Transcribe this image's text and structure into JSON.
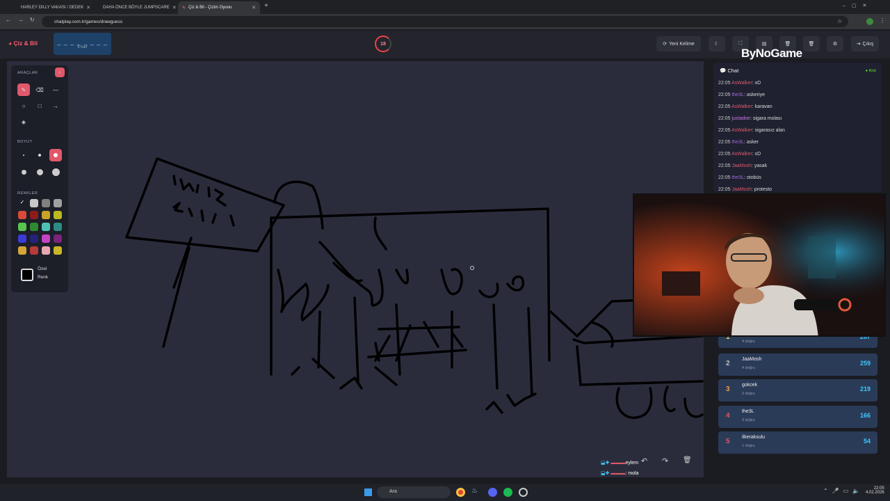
{
  "browser": {
    "tabs": [
      {
        "label": "HARLEY DILLY VAKASI / DEDEK"
      },
      {
        "label": "DAHA ÖNCE BÖYLE JUMPSCARE"
      },
      {
        "label": "Çiz & Bil - Çizim Oyunu"
      }
    ],
    "url": "chatplay.com.tr/games/drawguess"
  },
  "header": {
    "logo": "Çiz & Bil",
    "word_dashes": "_ _ _ _ _ _ _ _",
    "word_hint": "8 harf",
    "timer": "18",
    "new_word": "Yeni Kelime",
    "exit": "Çıkış",
    "watermark": "ByNoGame"
  },
  "tools": {
    "tools_title": "ARAÇLAR",
    "size_title": "BOYUT",
    "colors_title": "RENKLER",
    "custom_color": "Özel",
    "custom_color2": "Renk",
    "colors": [
      "#ffffff",
      "#c8c8c8",
      "#808080",
      "#a0a0a0",
      "#d94a3a",
      "#8c1c1c",
      "#c9a227",
      "#b8b820",
      "#57c44e",
      "#2e8a2e",
      "#4fc1b4",
      "#2c8c84",
      "#3b3bd6",
      "#23237a",
      "#c443c4",
      "#7a247a",
      "#d4a537",
      "#b83a3a",
      "#e8a8b0",
      "#c9b725"
    ]
  },
  "chat": {
    "title": "Chat",
    "platform": "Kick",
    "messages": [
      {
        "time": "22:05",
        "user": "AsWalker",
        "text": ": xD",
        "color": "#e0586a"
      },
      {
        "time": "22:05",
        "user": "the3L",
        "text": ": askeriye",
        "color": "#a46ad9"
      },
      {
        "time": "22:05",
        "user": "AsWalker",
        "text": ": karavan",
        "color": "#e0586a"
      },
      {
        "time": "22:05",
        "user": "justadoe",
        "text": ": sigara molası",
        "color": "#c57ce0"
      },
      {
        "time": "22:05",
        "user": "AsWalker",
        "text": ": sigarasız alan",
        "color": "#e0586a"
      },
      {
        "time": "22:05",
        "user": "the3L",
        "text": ": asker",
        "color": "#a46ad9"
      },
      {
        "time": "22:05",
        "user": "AsWalker",
        "text": ": xD",
        "color": "#e0586a"
      },
      {
        "time": "22:05",
        "user": "JaaMosh",
        "text": ": yasak",
        "color": "#e0586a"
      },
      {
        "time": "22:05",
        "user": "the3L",
        "text": ": otobüs",
        "color": "#a46ad9"
      },
      {
        "time": "22:05",
        "user": "JaaMosh",
        "text": ": protesto",
        "color": "#e0586a"
      }
    ]
  },
  "leaderboard": [
    {
      "rank": "1",
      "name": "",
      "sub": "4 doğru",
      "points": "287",
      "color": "#f2c94c"
    },
    {
      "rank": "2",
      "name": "JaaMosh",
      "sub": "4 doğru",
      "points": "259",
      "color": "#c0c0c0"
    },
    {
      "rank": "3",
      "name": "gokcek",
      "sub": "3 doğru",
      "points": "219",
      "color": "#f2994a"
    },
    {
      "rank": "4",
      "name": "the3L",
      "sub": "3 doğru",
      "points": "166",
      "color": "#e0586a"
    },
    {
      "rank": "5",
      "name": "ilkeraksulu",
      "sub": "1 doğru",
      "points": "54",
      "color": "#e0586a"
    }
  ],
  "overlay_chat": [
    {
      "text": "eylem"
    },
    {
      "text": ": mola"
    }
  ],
  "taskbar": {
    "search": "Ara",
    "time": "22:05",
    "date": "4.02.2026"
  }
}
